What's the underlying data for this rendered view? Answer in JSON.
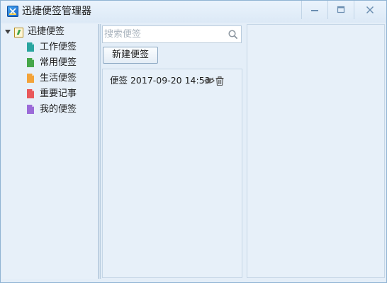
{
  "window": {
    "title": "迅捷便签管理器"
  },
  "tree": {
    "root_label": "迅捷便签",
    "children": [
      {
        "label": "工作便签",
        "icon": "note-teal-icon",
        "color": "#2aa5a0"
      },
      {
        "label": "常用便签",
        "icon": "note-green-icon",
        "color": "#45a64a"
      },
      {
        "label": "生活便签",
        "icon": "note-orange-icon",
        "color": "#f3a33a"
      },
      {
        "label": "重要记事",
        "icon": "note-red-icon",
        "color": "#e9585b"
      },
      {
        "label": "我的便签",
        "icon": "note-purple-icon",
        "color": "#9b6bd8"
      }
    ]
  },
  "search": {
    "placeholder": "搜索便签",
    "value": ""
  },
  "toolbar": {
    "new_label": "新建便签"
  },
  "notes": [
    {
      "title": "便签 2017-09-20 14:53"
    }
  ]
}
